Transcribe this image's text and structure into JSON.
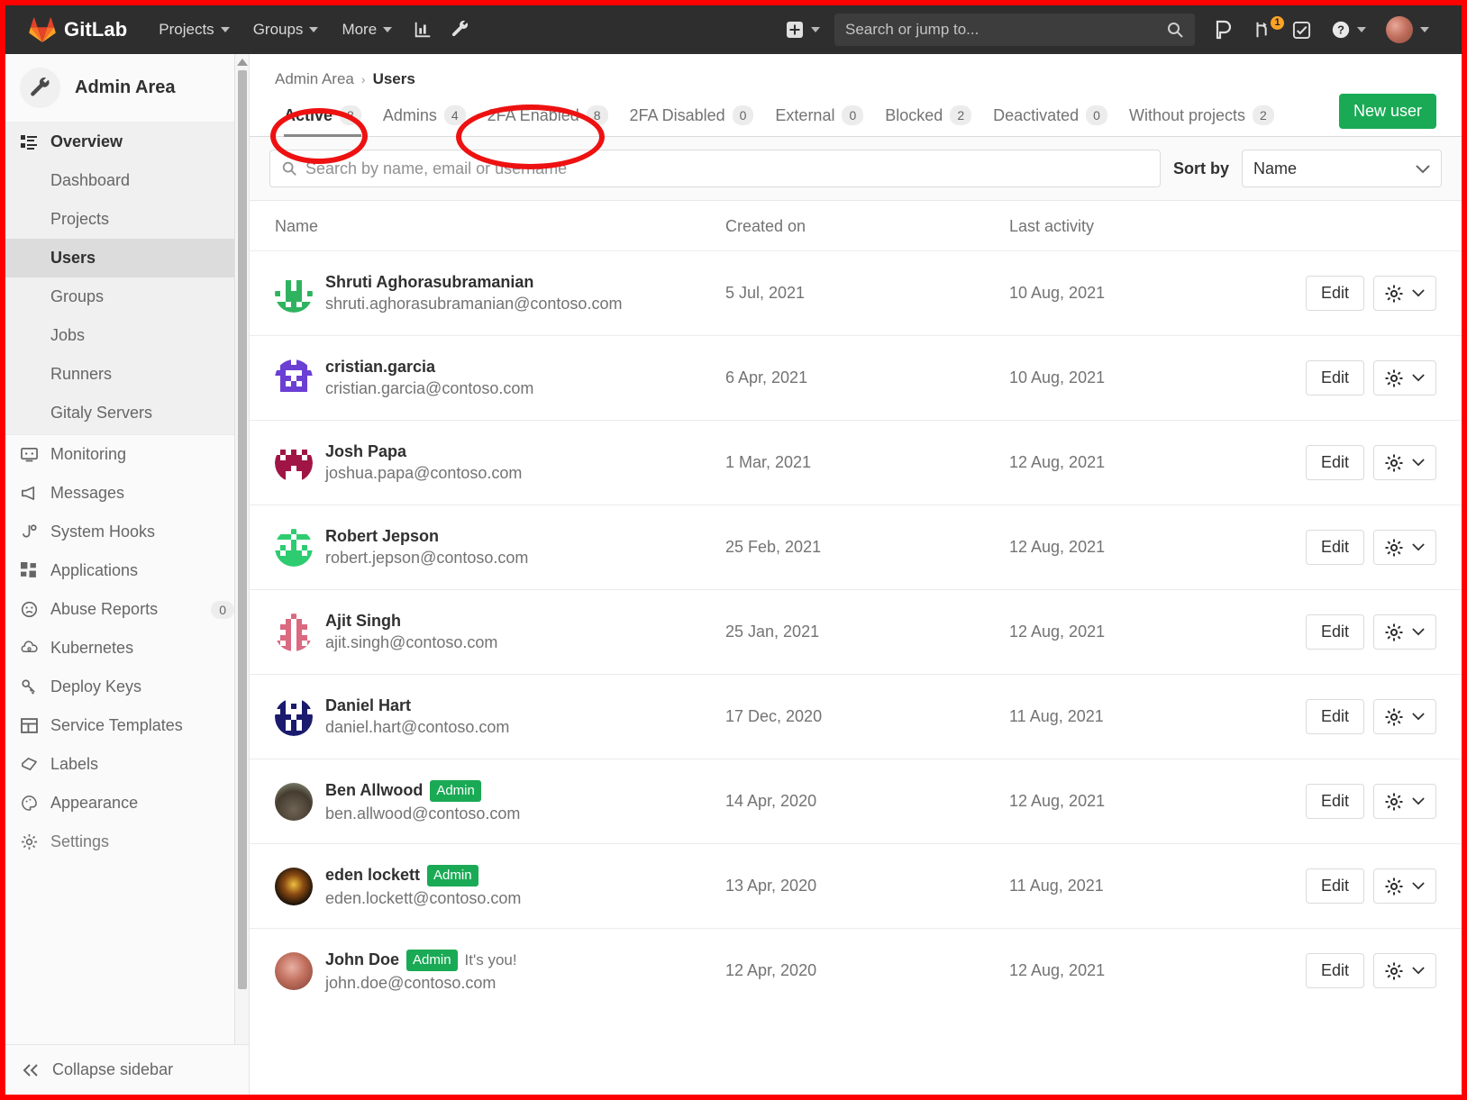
{
  "navbar": {
    "brand": "GitLab",
    "links": [
      {
        "label": "Projects",
        "icon": "chevron-down-icon"
      },
      {
        "label": "Groups",
        "icon": "chevron-down-icon"
      },
      {
        "label": "More",
        "icon": "chevron-down-icon"
      }
    ],
    "icons": [
      "analytics-icon",
      "wrench-icon"
    ],
    "create_menu": {
      "icon": "plus-square-icon",
      "label": ""
    },
    "search": {
      "placeholder": "Search or jump to...",
      "value": "",
      "icon": "search-icon"
    },
    "right_icons": [
      {
        "name": "issues-icon"
      },
      {
        "name": "merge-requests-icon",
        "badge": "1"
      },
      {
        "name": "todos-icon"
      },
      {
        "name": "help-icon"
      }
    ],
    "avatar_alt": "user-avatar"
  },
  "sidebar": {
    "title": "Admin Area",
    "title_icon": "wrench-icon",
    "overview": {
      "label": "Overview",
      "icon": "overview-icon"
    },
    "sub_items": [
      {
        "label": "Dashboard",
        "active": false
      },
      {
        "label": "Projects",
        "active": false
      },
      {
        "label": "Users",
        "active": true
      },
      {
        "label": "Groups",
        "active": false
      },
      {
        "label": "Jobs",
        "active": false
      },
      {
        "label": "Runners",
        "active": false
      },
      {
        "label": "Gitaly Servers",
        "active": false
      }
    ],
    "items": [
      {
        "label": "Monitoring",
        "icon": "monitor-icon",
        "count": ""
      },
      {
        "label": "Messages",
        "icon": "megaphone-icon",
        "count": ""
      },
      {
        "label": "System Hooks",
        "icon": "hook-icon",
        "count": ""
      },
      {
        "label": "Applications",
        "icon": "apps-icon",
        "count": ""
      },
      {
        "label": "Abuse Reports",
        "icon": "frown-icon",
        "count": "0"
      },
      {
        "label": "Kubernetes",
        "icon": "kubernetes-icon",
        "count": ""
      },
      {
        "label": "Deploy Keys",
        "icon": "key-icon",
        "count": ""
      },
      {
        "label": "Service Templates",
        "icon": "template-icon",
        "count": ""
      },
      {
        "label": "Labels",
        "icon": "label-icon",
        "count": ""
      },
      {
        "label": "Appearance",
        "icon": "palette-icon",
        "count": ""
      },
      {
        "label": "Settings",
        "icon": "gear-icon",
        "count": ""
      }
    ],
    "collapse": {
      "label": "Collapse sidebar",
      "icon": "chevron-double-left-icon"
    }
  },
  "breadcrumb": {
    "root": "Admin Area",
    "separator": "›",
    "current": "Users"
  },
  "tabs": [
    {
      "label": "Active",
      "count": "8",
      "active": true
    },
    {
      "label": "Admins",
      "count": "4",
      "active": false
    },
    {
      "label": "2FA Enabled",
      "count": "8",
      "active": false
    },
    {
      "label": "2FA Disabled",
      "count": "0",
      "active": false
    },
    {
      "label": "External",
      "count": "0",
      "active": false
    },
    {
      "label": "Blocked",
      "count": "2",
      "active": false
    },
    {
      "label": "Deactivated",
      "count": "0",
      "active": false
    },
    {
      "label": "Without projects",
      "count": "2",
      "active": false
    }
  ],
  "new_user_button": "New user",
  "filter": {
    "search_placeholder": "Search by name, email or username",
    "search_value": "",
    "sort_label": "Sort by",
    "sort_value": "Name",
    "sort_icon": "chevron-down-icon"
  },
  "table": {
    "columns": [
      "Name",
      "Created on",
      "Last activity",
      ""
    ],
    "rows": [
      {
        "name": "Shruti Aghorasubramanian",
        "email": "shruti.aghorasubramanian@contoso.com",
        "created": "5 Jul, 2021",
        "activity": "10 Aug, 2021",
        "admin": false,
        "its_you": false,
        "avatar_color": "#2fb35f",
        "avatar_kind": "identicon-rings"
      },
      {
        "name": "cristian.garcia",
        "email": "cristian.garcia@contoso.com",
        "created": "6 Apr, 2021",
        "activity": "10 Aug, 2021",
        "admin": false,
        "its_you": false,
        "avatar_color": "#6b3fd4",
        "avatar_kind": "identicon-blocks"
      },
      {
        "name": "Josh Papa",
        "email": "joshua.papa@contoso.com",
        "created": "1 Mar, 2021",
        "activity": "12 Aug, 2021",
        "admin": false,
        "its_you": false,
        "avatar_color": "#a01545",
        "avatar_kind": "identicon-dense"
      },
      {
        "name": "Robert Jepson",
        "email": "robert.jepson@contoso.com",
        "created": "25 Feb, 2021",
        "activity": "12 Aug, 2021",
        "admin": false,
        "its_you": false,
        "avatar_color": "#2ecc71",
        "avatar_kind": "identicon-center"
      },
      {
        "name": "Ajit Singh",
        "email": "ajit.singh@contoso.com",
        "created": "25 Jan, 2021",
        "activity": "12 Aug, 2021",
        "admin": false,
        "its_you": false,
        "avatar_color": "#da6a80",
        "avatar_kind": "identicon-mesh"
      },
      {
        "name": "Daniel Hart",
        "email": "daniel.hart@contoso.com",
        "created": "17 Dec, 2020",
        "activity": "11 Aug, 2021",
        "admin": false,
        "its_you": false,
        "avatar_color": "#1a1a6e",
        "avatar_kind": "identicon-dots"
      },
      {
        "name": "Ben Allwood",
        "email": "ben.allwood@contoso.com",
        "created": "14 Apr, 2020",
        "activity": "12 Aug, 2021",
        "admin": true,
        "its_you": false,
        "avatar_color": "#6b6050",
        "avatar_kind": "photo-landscape"
      },
      {
        "name": "eden lockett",
        "email": "eden.lockett@contoso.com",
        "created": "13 Apr, 2020",
        "activity": "11 Aug, 2021",
        "admin": true,
        "its_you": false,
        "avatar_color": "#1c1510",
        "avatar_kind": "photo-dark"
      },
      {
        "name": "John Doe",
        "email": "john.doe@contoso.com",
        "created": "12 Apr, 2020",
        "activity": "12 Aug, 2021",
        "admin": true,
        "its_you": true,
        "avatar_color": "#c27a72",
        "avatar_kind": "photo-portrait"
      }
    ],
    "admin_badge": "Admin",
    "its_you_text": "It's you!",
    "edit_label": "Edit",
    "gear_icon": "gear-icon",
    "gear_caret_icon": "chevron-down-icon"
  },
  "annotations": [
    {
      "name": "highlight-active-tab",
      "shape": "ellipse",
      "color": "#ee1111"
    },
    {
      "name": "highlight-2fa-enabled-tab",
      "shape": "ellipse",
      "color": "#ee1111"
    },
    {
      "name": "screenshot-border",
      "shape": "rect",
      "color": "#ff0000"
    }
  ]
}
